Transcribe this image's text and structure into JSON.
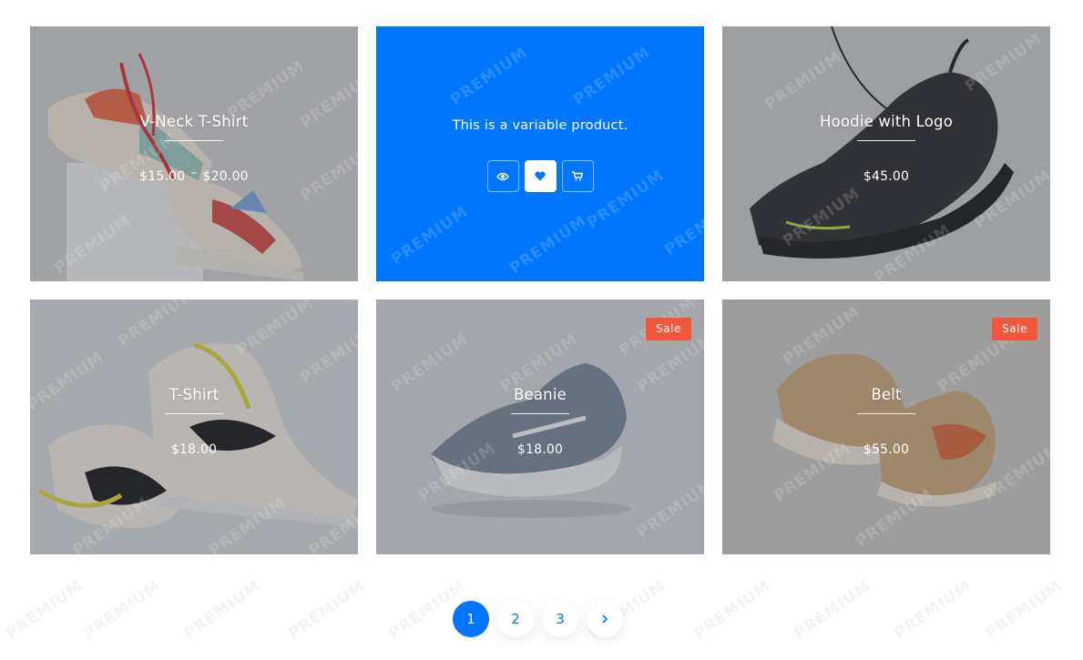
{
  "products": [
    {
      "title": "V-Neck T-Shirt",
      "price_min": "$15.00",
      "price_sep": "–",
      "price_max": "$20.00",
      "sale": false
    },
    {
      "description": "This is a variable product.",
      "hovered": true
    },
    {
      "title": "Hoodie with Logo",
      "price": "$45.00",
      "sale": false
    },
    {
      "title": "T-Shirt",
      "price": "$18.00",
      "sale": false
    },
    {
      "title": "Beanie",
      "price": "$18.00",
      "sale": true,
      "sale_label": "Sale"
    },
    {
      "title": "Belt",
      "price": "$55.00",
      "sale": true,
      "sale_label": "Sale"
    }
  ],
  "actions": {
    "quick_view_icon": "eye-icon",
    "wishlist_icon": "heart-icon",
    "cart_icon": "cart-icon"
  },
  "watermark": "PREMIUM",
  "pagination": {
    "pages": [
      "1",
      "2",
      "3"
    ],
    "current": "1",
    "next_icon": "chevron-right-icon"
  },
  "colors": {
    "accent": "#0076ff",
    "sale": "#f2573c"
  }
}
